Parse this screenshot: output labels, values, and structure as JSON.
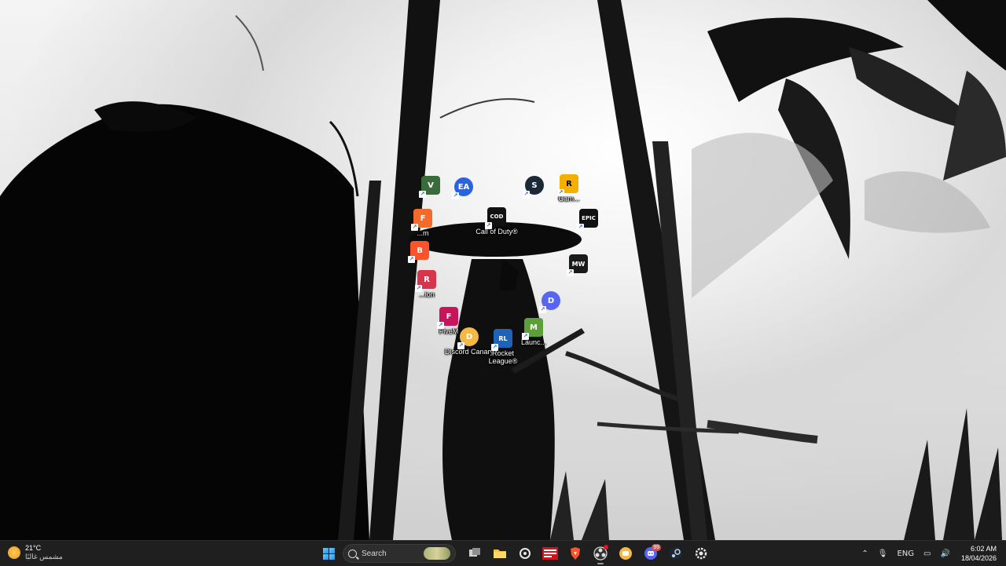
{
  "desktop": {
    "icons": [
      {
        "id": "gta-v",
        "label": "",
        "glyph": "V",
        "color": "#3a6b3a"
      },
      {
        "id": "ea-app",
        "label": "",
        "glyph": "EA",
        "color": "#2a63e0"
      },
      {
        "id": "steam",
        "label": "",
        "glyph": "S",
        "color": "#1b2838"
      },
      {
        "id": "rockstar-launcher",
        "label": "Gam...",
        "glyph": "R",
        "color": "#f3b000"
      },
      {
        "id": "faceit",
        "label": "...m",
        "glyph": "F",
        "color": "#f26b2a"
      },
      {
        "id": "call-of-duty",
        "label": "Call of Duty®",
        "glyph": "COD",
        "color": "#111111"
      },
      {
        "id": "epic-games",
        "label": "",
        "glyph": "EPIC",
        "color": "#111111"
      },
      {
        "id": "brave",
        "label": "",
        "glyph": "B",
        "color": "#fb542b"
      },
      {
        "id": "mw",
        "label": "",
        "glyph": "MW",
        "color": "#1a1a1a"
      },
      {
        "id": "roblox",
        "label": "...ion",
        "glyph": "R",
        "color": "#d8344c"
      },
      {
        "id": "discord",
        "label": "",
        "glyph": "D",
        "color": "#5865f2"
      },
      {
        "id": "fivem",
        "label": "FiveM",
        "glyph": "F",
        "color": "#c6155a"
      },
      {
        "id": "discord-canary",
        "label": "Discord Canary",
        "glyph": "D",
        "color": "#f4b844"
      },
      {
        "id": "rocket-league",
        "label": "Rocket League®",
        "glyph": "RL",
        "color": "#1e63b6"
      },
      {
        "id": "minecraft-launcher",
        "label": "Launc...",
        "glyph": "M",
        "color": "#5c9e3a"
      }
    ]
  },
  "taskbar": {
    "weather": {
      "temp": "21°C",
      "condition": "مشمس غالبًا"
    },
    "search": {
      "placeholder": "Search"
    },
    "apps": [
      {
        "id": "start",
        "icon": "windows-start-icon"
      },
      {
        "id": "search",
        "icon": "search-icon"
      },
      {
        "id": "task-view",
        "icon": "task-view-icon"
      },
      {
        "id": "file-explorer",
        "icon": "folder-icon"
      },
      {
        "id": "steam-tb",
        "icon": "steam-icon"
      },
      {
        "id": "news-app",
        "icon": "news-icon"
      },
      {
        "id": "brave-tb",
        "icon": "brave-icon"
      },
      {
        "id": "obs",
        "icon": "obs-icon"
      },
      {
        "id": "discord-canary-tb",
        "icon": "discord-canary-icon"
      },
      {
        "id": "discord-tb",
        "icon": "discord-icon",
        "badge": "99"
      },
      {
        "id": "steam-tb-2",
        "icon": "steam-icon"
      },
      {
        "id": "settings-tb",
        "icon": "gear-icon"
      }
    ],
    "tray": {
      "language": "ENG",
      "time": "6:02 AM",
      "date": "18/04/2026"
    }
  }
}
